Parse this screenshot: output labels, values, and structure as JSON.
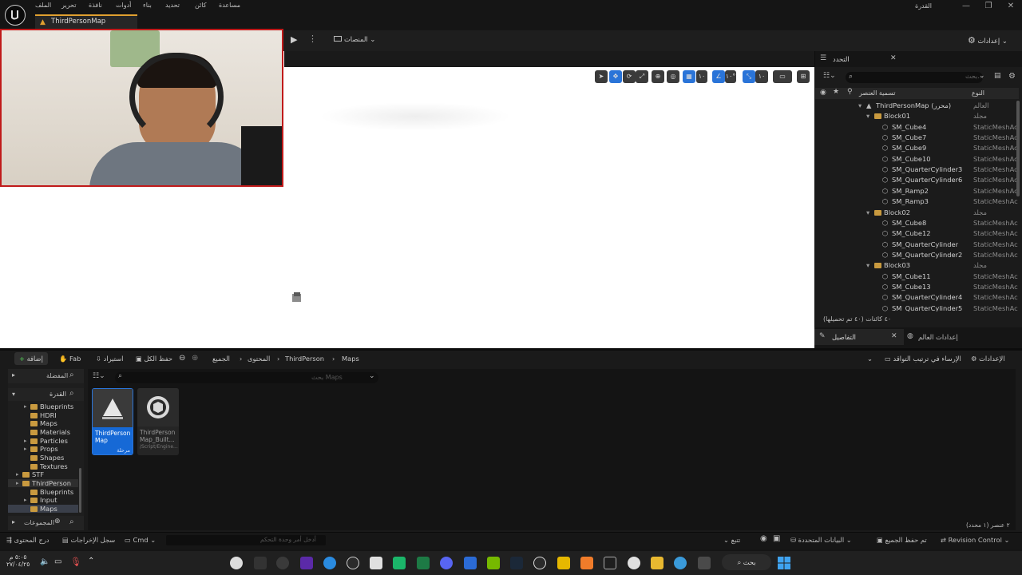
{
  "menu": [
    "الملف",
    "تحرير",
    "نافذة",
    "أدوات",
    "بناء",
    "تحديد",
    "كائن",
    "مساعدة"
  ],
  "project_name": "القدرة",
  "doc_tab": "ThirdPersonMap",
  "toolbar": {
    "platforms": "المنصات",
    "settings": "إعدادات"
  },
  "viewport": {
    "snap_value": "١٠",
    "angle_value": "١٠°",
    "scale_value": "١٠"
  },
  "outliner": {
    "title": "التحدد",
    "search_placeholder": "بحث...",
    "col_label": "تسمية العنصر",
    "col_type": "النوع",
    "rows": [
      {
        "name": "ThirdPersonMap (محرر)",
        "type": "العالم",
        "kind": "world",
        "indent": 0
      },
      {
        "name": "Block01",
        "type": "مجلد",
        "kind": "folder",
        "indent": 1
      },
      {
        "name": "SM_Cube4",
        "type": "StaticMeshAc",
        "kind": "mesh",
        "indent": 2
      },
      {
        "name": "SM_Cube7",
        "type": "StaticMeshAc",
        "kind": "mesh",
        "indent": 2
      },
      {
        "name": "SM_Cube9",
        "type": "StaticMeshAc",
        "kind": "mesh",
        "indent": 2
      },
      {
        "name": "SM_Cube10",
        "type": "StaticMeshAc",
        "kind": "mesh",
        "indent": 2
      },
      {
        "name": "SM_QuarterCylinder3",
        "type": "StaticMeshAc",
        "kind": "mesh",
        "indent": 2
      },
      {
        "name": "SM_QuarterCylinder6",
        "type": "StaticMeshAc",
        "kind": "mesh",
        "indent": 2
      },
      {
        "name": "SM_Ramp2",
        "type": "StaticMeshAc",
        "kind": "mesh",
        "indent": 2
      },
      {
        "name": "SM_Ramp3",
        "type": "StaticMeshAc",
        "kind": "mesh",
        "indent": 2
      },
      {
        "name": "Block02",
        "type": "مجلد",
        "kind": "folder",
        "indent": 1
      },
      {
        "name": "SM_Cube8",
        "type": "StaticMeshAc",
        "kind": "mesh",
        "indent": 2
      },
      {
        "name": "SM_Cube12",
        "type": "StaticMeshAc",
        "kind": "mesh",
        "indent": 2
      },
      {
        "name": "SM_QuarterCylinder",
        "type": "StaticMeshAc",
        "kind": "mesh",
        "indent": 2
      },
      {
        "name": "SM_QuarterCylinder2",
        "type": "StaticMeshAc",
        "kind": "mesh",
        "indent": 2
      },
      {
        "name": "Block03",
        "type": "مجلد",
        "kind": "folder",
        "indent": 1
      },
      {
        "name": "SM_Cube11",
        "type": "StaticMeshAc",
        "kind": "mesh",
        "indent": 2
      },
      {
        "name": "SM_Cube13",
        "type": "StaticMeshAc",
        "kind": "mesh",
        "indent": 2
      },
      {
        "name": "SM_QuarterCylinder4",
        "type": "StaticMeshAc",
        "kind": "mesh",
        "indent": 2
      },
      {
        "name": "SM_QuarterCylinder5",
        "type": "StaticMeshAc",
        "kind": "mesh",
        "indent": 2
      }
    ],
    "footer": "٤٠ كائنات (٤٠ تم تحميلها)"
  },
  "details": {
    "details_tab": "التفاصيل",
    "world_settings_tab": "إعدادات العالم"
  },
  "content_browser": {
    "add_label": "إضافة",
    "fab_label": "Fab",
    "import_label": "استيراد",
    "save_all_label": "حفظ الكل",
    "breadcrumb": [
      "الجميع",
      "المحتوى",
      "ThirdPerson",
      "Maps"
    ],
    "dock_label": "الإرساء في ترتيب التواقد",
    "settings_label": "الإعدادات",
    "search_placeholder": "بحث Maps",
    "favorites_label": "المفضلة",
    "root_label": "القدرة",
    "collections_label": "المجموعات",
    "tree": [
      {
        "name": "Blueprints",
        "level": 1,
        "arrow": true
      },
      {
        "name": "HDRI",
        "level": 1,
        "arrow": false
      },
      {
        "name": "Maps",
        "level": 1,
        "arrow": false
      },
      {
        "name": "Materials",
        "level": 1,
        "arrow": false
      },
      {
        "name": "Particles",
        "level": 1,
        "arrow": true
      },
      {
        "name": "Props",
        "level": 1,
        "arrow": true
      },
      {
        "name": "Shapes",
        "level": 1,
        "arrow": false
      },
      {
        "name": "Textures",
        "level": 1,
        "arrow": false
      },
      {
        "name": "STF",
        "level": 0,
        "arrow": true
      },
      {
        "name": "ThirdPerson",
        "level": 0,
        "arrow": true
      },
      {
        "name": "Blueprints",
        "level": 1,
        "arrow": false
      },
      {
        "name": "Input",
        "level": 1,
        "arrow": true
      },
      {
        "name": "Maps",
        "level": 1,
        "arrow": false
      }
    ],
    "assets": [
      {
        "name": "ThirdPerson Map",
        "sub": "مرحلة",
        "selected": true
      },
      {
        "name": "ThirdPerson Map_Built...",
        "sub": "/Script/Engine...",
        "selected": false
      }
    ],
    "item_count": "٢ عنصر (١ محدد)"
  },
  "statusbar": {
    "content_drawer": "درج المحتوى",
    "output_log": "سجل الإخراجات",
    "cmd": "Cmd",
    "cmd_placeholder": "أدخل أمر وحدة التحكم",
    "trace": "تتبع",
    "derived_data": "البيانات المتحددة",
    "all_saved": "تم حفظ الجميع",
    "revision_control": "Revision Control"
  },
  "taskbar": {
    "search": "بحث",
    "time": "٥:٠٥ م",
    "date": "٢٧/٠٤/٢٥"
  }
}
